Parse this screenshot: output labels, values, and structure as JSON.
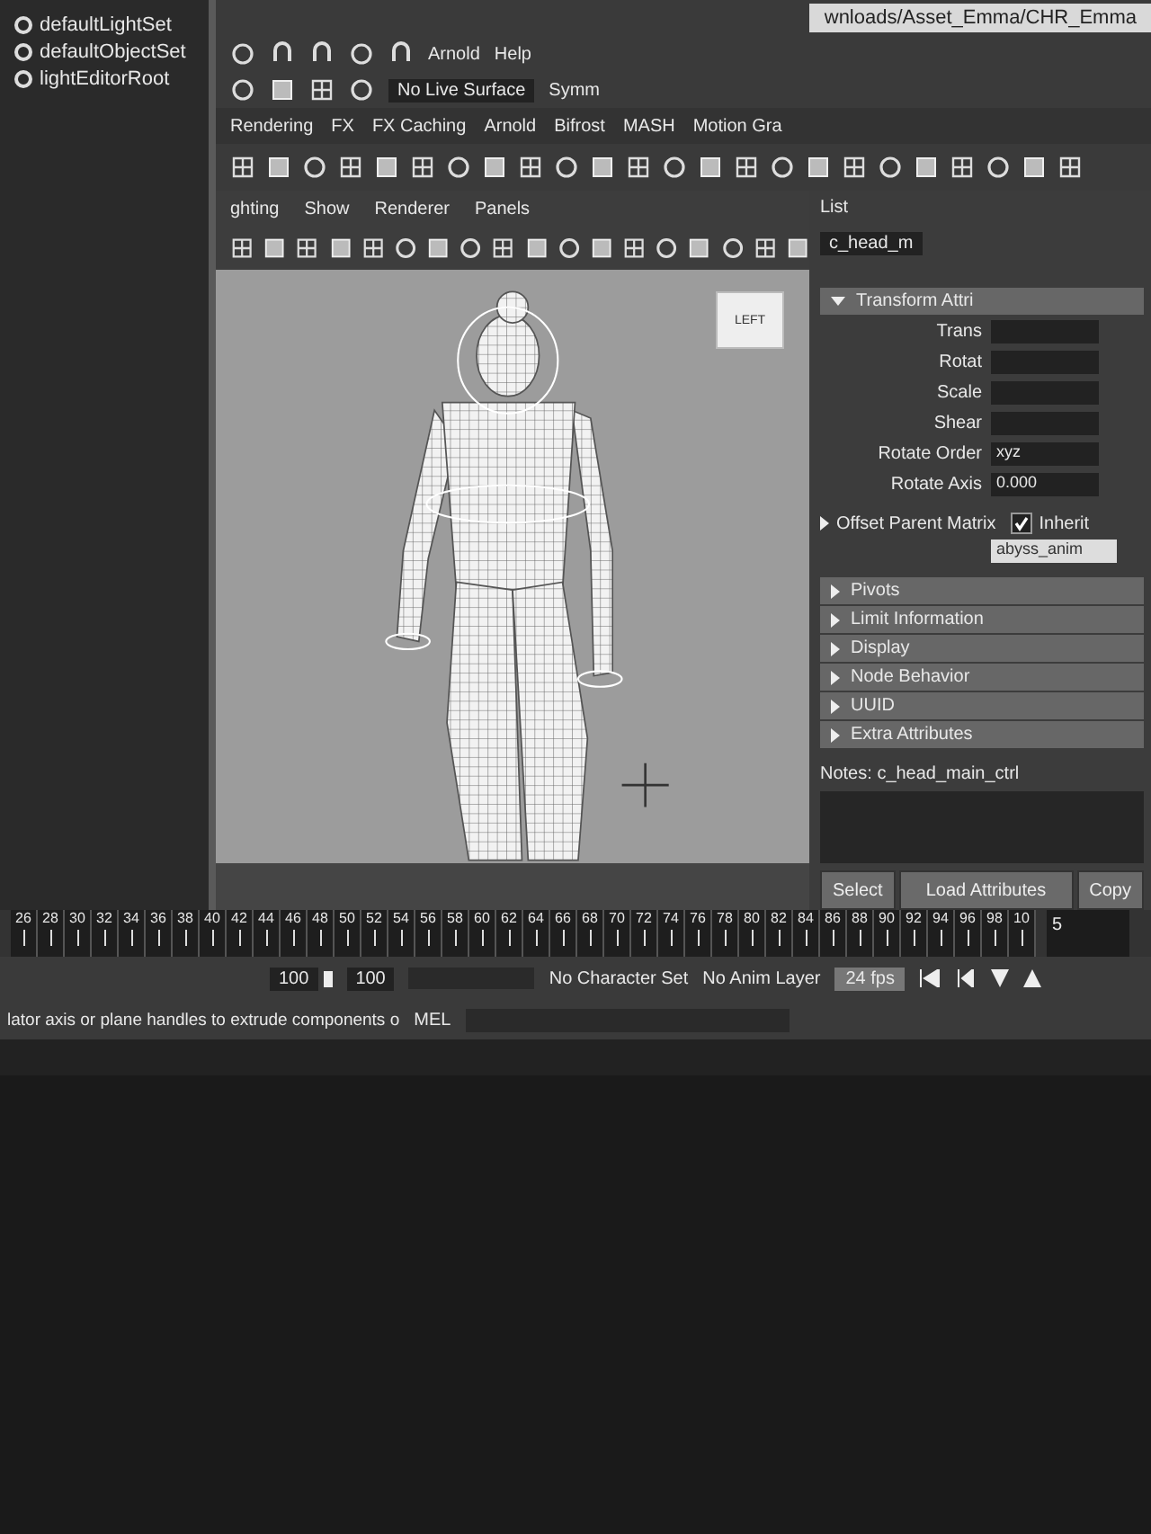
{
  "title_bar": {
    "path": "wnloads/Asset_Emma/CHR_Emma"
  },
  "menu_bar": {
    "items": [
      "Arnold",
      "Help"
    ]
  },
  "status_line": {
    "live_surface": "No Live Surface",
    "symmetry": "Symm"
  },
  "shelf_tabs": [
    "Rendering",
    "FX",
    "FX Caching",
    "Arnold",
    "Bifrost",
    "MASH",
    "Motion Gra"
  ],
  "outliner": {
    "items": [
      "defaultLightSet",
      "defaultObjectSet",
      "lightEditorRoot"
    ]
  },
  "viewport": {
    "menu": [
      "ghting",
      "Show",
      "Renderer",
      "Panels"
    ],
    "view_cube": "LEFT"
  },
  "attribute_editor": {
    "header": "List",
    "node_name": "c_head_m",
    "transform": {
      "label": "Transform Attri",
      "expanded": true,
      "fields": [
        {
          "label": "Trans"
        },
        {
          "label": "Rotat"
        },
        {
          "label": "Scale"
        },
        {
          "label": "Shear"
        },
        {
          "label": "Rotate Order",
          "value": "xyz"
        },
        {
          "label": "Rotate Axis",
          "value": "0.000"
        }
      ]
    },
    "offset_parent_matrix": {
      "label": "Offset Parent Matrix",
      "expanded": false
    },
    "inherit": {
      "label": "Inherit",
      "checked": true
    },
    "layer_field": "abyss_anim",
    "sections": [
      {
        "label": "Pivots",
        "expanded": false
      },
      {
        "label": "Limit Information",
        "expanded": false
      },
      {
        "label": "Display",
        "expanded": false
      },
      {
        "label": "Node Behavior",
        "expanded": false
      },
      {
        "label": "UUID",
        "expanded": false
      },
      {
        "label": "Extra Attributes",
        "expanded": false
      }
    ],
    "notes_label": "Notes:",
    "notes_node": "c_head_main_ctrl",
    "buttons": [
      "Select",
      "Load Attributes",
      "Copy"
    ]
  },
  "timeline": {
    "ticks": [
      "26",
      "28",
      "30",
      "32",
      "34",
      "36",
      "38",
      "40",
      "42",
      "44",
      "46",
      "48",
      "50",
      "52",
      "54",
      "56",
      "58",
      "60",
      "62",
      "64",
      "66",
      "68",
      "70",
      "72",
      "74",
      "76",
      "78",
      "80",
      "82",
      "84",
      "86",
      "88",
      "90",
      "92",
      "94",
      "96",
      "98",
      "10"
    ],
    "current_frame": "5"
  },
  "range": {
    "start": "100",
    "end": "100",
    "character_set": "No Character Set",
    "anim_layer": "No Anim Layer",
    "fps": "24 fps"
  },
  "command_line": {
    "language": "MEL",
    "help": "lator axis or plane handles to extrude components o"
  }
}
